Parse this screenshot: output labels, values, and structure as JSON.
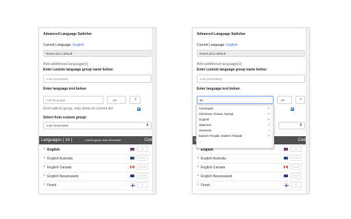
{
  "title": "Advanced Language Switcher",
  "current_language_label": "Current Language:",
  "current_language_value": "English",
  "reset_label": "Reset all to default",
  "add_additional_label": "Add additional language(s):",
  "custom_group_label": "Enter custom language group name below:",
  "group_name_placeholder": "Auto Generated",
  "language_text_label": "Enter language text below:",
  "left_language_input_placeholder": "Add language",
  "right_language_input_value": "Ja",
  "code_input_value": "en",
  "add_button": "+",
  "dont_add_label": "Don't add to group, only show on current list:",
  "select_group_label": "Select from custom group:",
  "select_group_value": "Auto Generated",
  "select_arrow": "⬍",
  "table_header": {
    "languages": "Languages ( 14 )",
    "current_group": "Current group: Auto Generated",
    "code": "Code"
  },
  "remove_symbol": "×",
  "rows": [
    {
      "name": "English",
      "code": "en",
      "flag": "uk-flag-icon",
      "bold": true
    },
    {
      "name": "English Australia",
      "code": "en-au",
      "flag": "au-flag-icon",
      "bold": false
    },
    {
      "name": "English Canada",
      "code": "en-ca",
      "flag": "ca-flag-icon",
      "bold": false
    },
    {
      "name": "English Newzealand",
      "code": "en-nz",
      "flag": "nz-flag-icon",
      "bold": false
    },
    {
      "name": "Finish",
      "code": "fi",
      "flag": "fi-flag-icon",
      "bold": false
    }
  ],
  "dropdown": [
    {
      "name": "Azerbaijani",
      "code": "az"
    },
    {
      "name": "Chichewa, Chewa, Nyanja",
      "code": "ny"
    },
    {
      "name": "Gujarati",
      "code": "gu"
    },
    {
      "name": "Japanese",
      "code": "ja"
    },
    {
      "name": "Javanese",
      "code": "jv"
    },
    {
      "name": "Eastern Punjabi, Eastern Panjabi",
      "code": "pa"
    },
    {
      "name": "...",
      "code": ""
    }
  ],
  "colors": {
    "accent": "#2a6fd6",
    "header": "#505050",
    "remove": "#d33333"
  }
}
